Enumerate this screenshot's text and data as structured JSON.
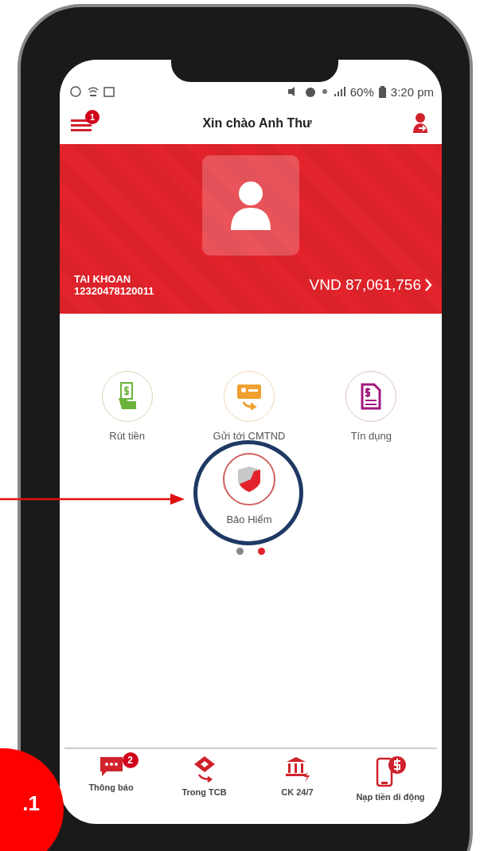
{
  "status_bar": {
    "battery": "60%",
    "time": "3:20 pm"
  },
  "header": {
    "title": "Xin chào Anh Thư",
    "menu_badge": "1"
  },
  "account": {
    "label": "TAI KHOAN",
    "number": "12320478120011",
    "balance": "VND 87,061,756"
  },
  "services": [
    {
      "label": "Rút tiền",
      "kind": "withdraw",
      "highlighted": false
    },
    {
      "label": "Gửi tới CMTND",
      "kind": "send-id",
      "highlighted": false
    },
    {
      "label": "Tín dụng",
      "kind": "credit",
      "highlighted": false
    },
    {
      "label": "Bảo Hiểm",
      "kind": "insurance",
      "highlighted": true
    }
  ],
  "pager": [
    {
      "selected": false
    },
    {
      "selected": true
    }
  ],
  "bottom_nav": [
    {
      "label": "Thông báo",
      "kind": "messages",
      "badge": "2"
    },
    {
      "label": "Trong TCB",
      "kind": "transfer"
    },
    {
      "label": "CK 24/7",
      "kind": "bank"
    },
    {
      "label": "Nạp tiền di động",
      "kind": "topup"
    }
  ],
  "step_badge": ".1"
}
